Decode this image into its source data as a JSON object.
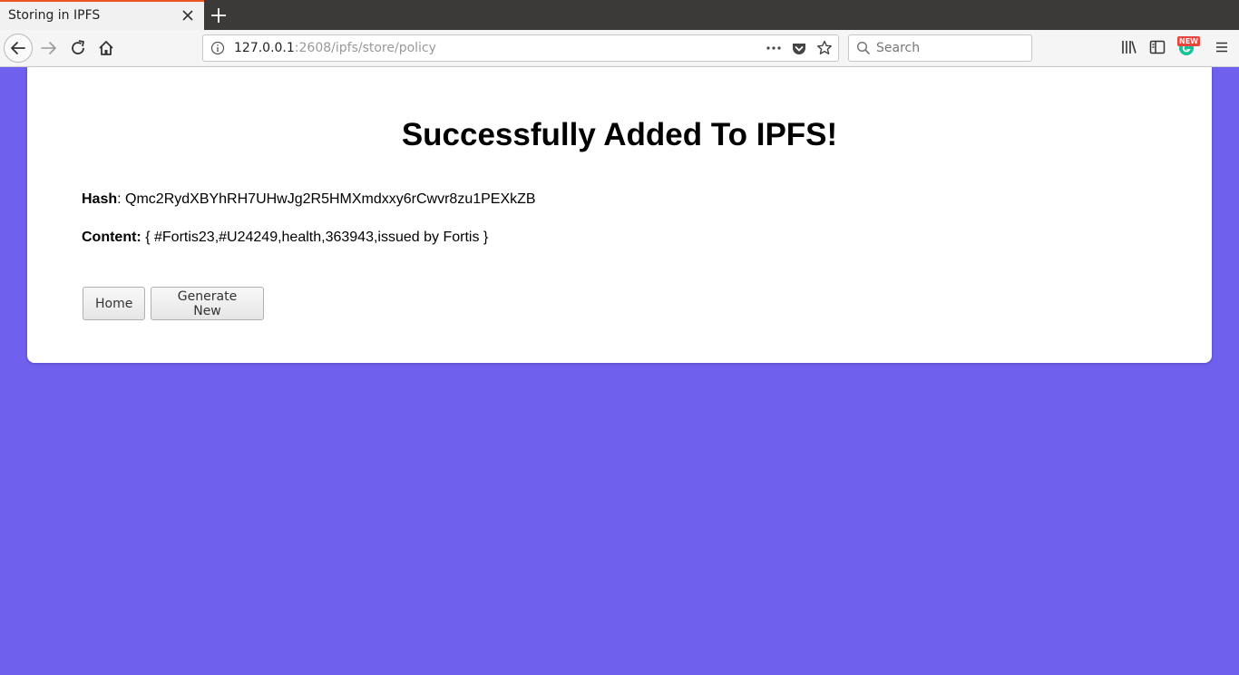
{
  "browser": {
    "tab_title": "Storing in IPFS",
    "url_host": "127.0.0.1",
    "url_rest": ":2608/ipfs/store/policy",
    "search_placeholder": "Search",
    "new_badge": "NEW"
  },
  "page": {
    "title": "Successfully Added To IPFS!",
    "hash_label": "Hash",
    "hash_value": ": Qmc2RydXBYhRH7UHwJg2R5HMXmdxxy6rCwvr8zu1PEXkZB",
    "content_label": "Content:",
    "content_value": " { #Fortis23,#U24249,health,363943,issued by Fortis }",
    "buttons": {
      "home": "Home",
      "generate_new": "Generate New"
    }
  },
  "colors": {
    "background": "#6f60ee",
    "tab_accent": "#e95420",
    "card": "#ffffff"
  }
}
